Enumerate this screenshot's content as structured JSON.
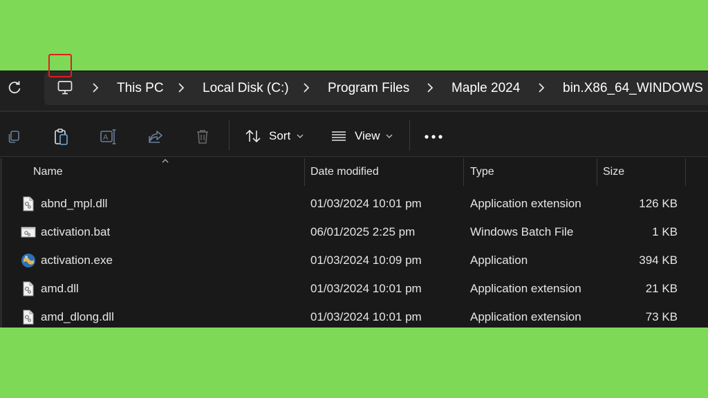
{
  "breadcrumbs": [
    "This PC",
    "Local Disk (C:)",
    "Program Files",
    "Maple 2024",
    "bin.X86_64_WINDOWS"
  ],
  "toolbar": {
    "sort_label": "Sort",
    "view_label": "View"
  },
  "columns": {
    "name": "Name",
    "date": "Date modified",
    "type": "Type",
    "size": "Size"
  },
  "files": [
    {
      "name": "abnd_mpl.dll",
      "date": "01/03/2024 10:01 pm",
      "type": "Application extension",
      "size": "126 KB",
      "icon": "dll-file-icon"
    },
    {
      "name": "activation.bat",
      "date": "06/01/2025 2:25 pm",
      "type": "Windows Batch File",
      "size": "1 KB",
      "icon": "batch-file-icon"
    },
    {
      "name": "activation.exe",
      "date": "01/03/2024 10:09 pm",
      "type": "Application",
      "size": "394 KB",
      "icon": "exe-file-icon"
    },
    {
      "name": "amd.dll",
      "date": "01/03/2024 10:01 pm",
      "type": "Application extension",
      "size": "21 KB",
      "icon": "dll-file-icon"
    },
    {
      "name": "amd_dlong.dll",
      "date": "01/03/2024 10:01 pm",
      "type": "Application extension",
      "size": "73 KB",
      "icon": "dll-file-icon"
    }
  ],
  "colors": {
    "background": "#7ed957",
    "window": "#191919",
    "highlight_box": "#e01e1e"
  }
}
